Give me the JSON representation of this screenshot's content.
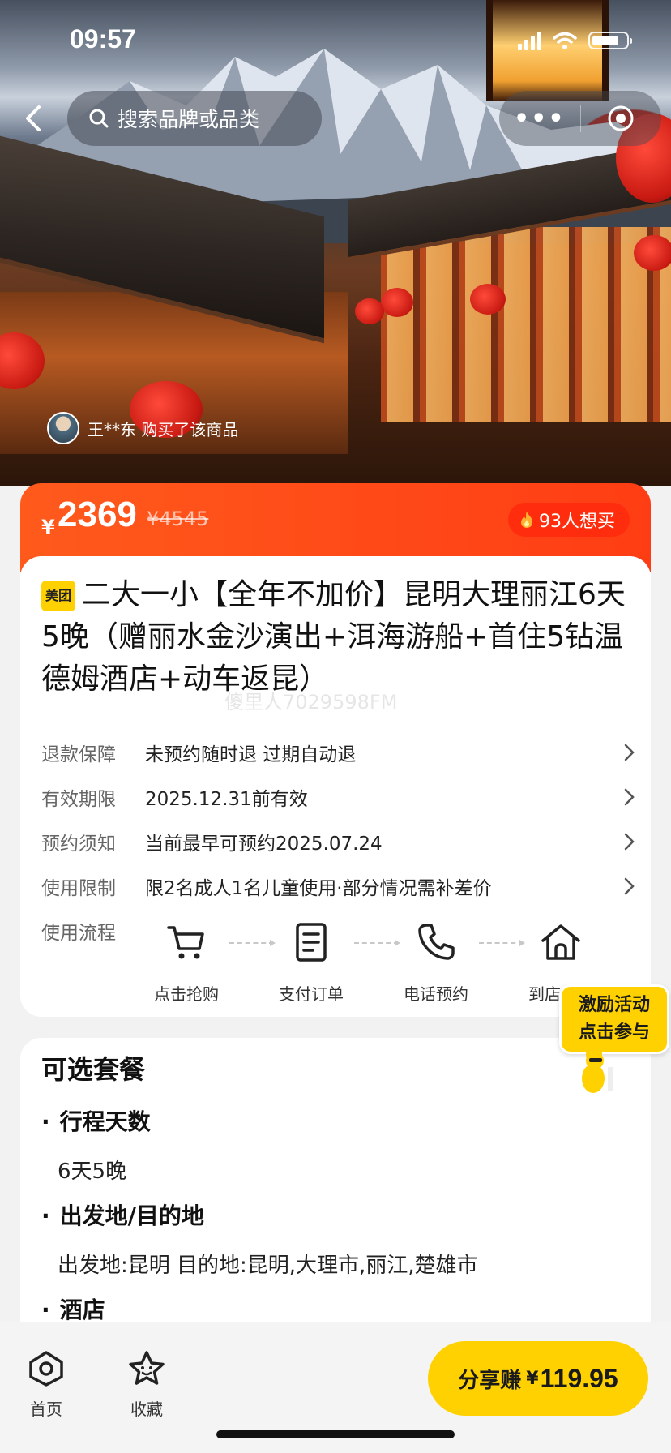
{
  "status_bar": {
    "time": "09:57"
  },
  "nav": {
    "search_placeholder": "搜索品牌或品类",
    "more": "•••"
  },
  "hero": {
    "buyer_text": "王**东 购买了该商品"
  },
  "price": {
    "currency": "¥",
    "current": "2369",
    "original": "¥4545",
    "want_count": "93人想买"
  },
  "product": {
    "brand_badge": "美团",
    "title": "二大一小【全年不加价】昆明大理丽江6天5晚（赠丽水金沙演出+洱海游船+首住5钻温德姆酒店+动车返昆）",
    "watermark": "傻里人7029598FM"
  },
  "info_rows": [
    {
      "label": "退款保障",
      "value": "未预约随时退 过期自动退"
    },
    {
      "label": "有效期限",
      "value": "2025.12.31前有效"
    },
    {
      "label": "预约须知",
      "value": "当前最早可预约2025.07.24"
    },
    {
      "label": "使用限制",
      "value": "限2名成人1名儿童使用·部分情况需补差价"
    }
  ],
  "flow": {
    "label": "使用流程",
    "steps": [
      {
        "label": "点击抢购",
        "icon": "cart-icon"
      },
      {
        "label": "支付订单",
        "icon": "document-icon"
      },
      {
        "label": "电话预约",
        "icon": "phone-icon"
      },
      {
        "label": "到店使用",
        "icon": "house-icon"
      }
    ]
  },
  "activity": {
    "line1": "激励活动",
    "line2": "点击参与"
  },
  "packages": {
    "title": "可选套餐",
    "options": [
      {
        "heading": "行程天数",
        "value": "6天5晚"
      },
      {
        "heading": "出发地/目的地",
        "value": "出发地:昆明 目的地:昆明,大理市,丽江,楚雄市"
      },
      {
        "heading": "酒店",
        "value": ""
      }
    ]
  },
  "bottom_bar": {
    "home": "首页",
    "favorite": "收藏",
    "share_label": "分享赚",
    "share_currency": "¥",
    "share_amount": "119.95"
  },
  "colors": {
    "accent_orange": "#ff4a18",
    "brand_yellow": "#ffd100"
  }
}
